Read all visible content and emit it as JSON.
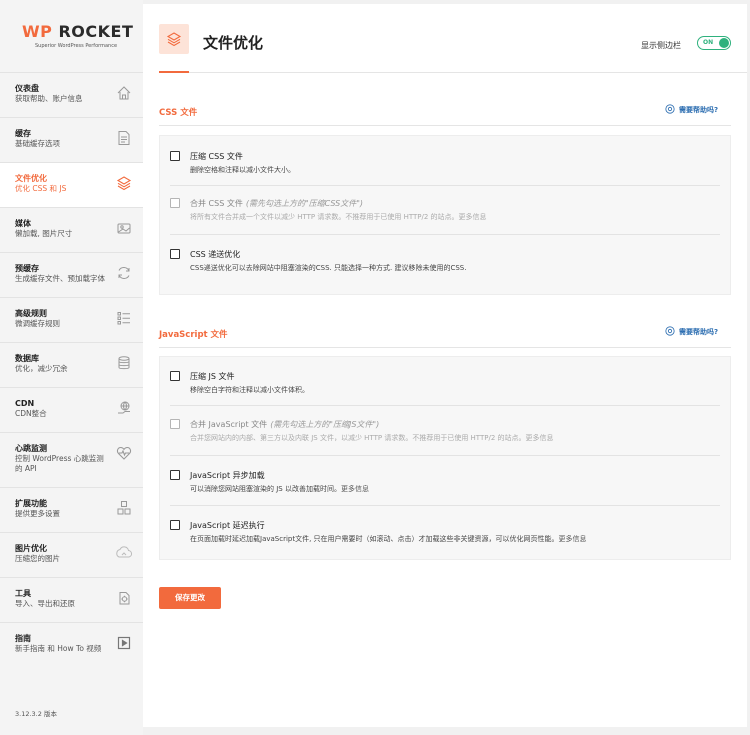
{
  "brand": {
    "name_wp": "WP",
    "name_rest": " ROCKET",
    "tagline": "Superior WordPress Performance"
  },
  "sidebar": {
    "items": [
      {
        "title": "仪表盘",
        "subtitle": "获取帮助、账户信息",
        "icon": "home-icon"
      },
      {
        "title": "缓存",
        "subtitle": "基础缓存选项",
        "icon": "file-icon"
      },
      {
        "title": "文件优化",
        "subtitle": "优化 CSS 和 JS",
        "icon": "layers-icon",
        "active": true
      },
      {
        "title": "媒体",
        "subtitle": "懒加载, 图片尺寸",
        "icon": "image-icon"
      },
      {
        "title": "预缓存",
        "subtitle": "生成缓存文件、预加载字体",
        "icon": "refresh-icon"
      },
      {
        "title": "高级规则",
        "subtitle": "微调缓存规则",
        "icon": "list-icon"
      },
      {
        "title": "数据库",
        "subtitle": "优化，减少冗余",
        "icon": "database-icon"
      },
      {
        "title": "CDN",
        "subtitle": "CDN整合",
        "icon": "cdn-icon"
      },
      {
        "title": "心跳监测",
        "subtitle": "控制 WordPress 心跳监测的 API",
        "icon": "heartbeat-icon"
      },
      {
        "title": "扩展功能",
        "subtitle": "提供更多设置",
        "icon": "addons-icon"
      },
      {
        "title": "图片优化",
        "subtitle": "压缩您的图片",
        "icon": "image-compress-icon"
      },
      {
        "title": "工具",
        "subtitle": "导入、导出和还原",
        "icon": "tools-icon"
      },
      {
        "title": "指南",
        "subtitle": "新手指南 和 How To 视频",
        "icon": "play-icon"
      }
    ],
    "version": "3.12.3.2 版本"
  },
  "header": {
    "title": "文件优化",
    "sidebar_toggle_label": "显示侧边栏",
    "toggle_state": "ON"
  },
  "css_section": {
    "title": "CSS 文件",
    "help": "需要帮助吗?",
    "options": [
      {
        "label": "压缩 CSS 文件",
        "hint": "",
        "desc": "删除空格和注释以减小文件大小。",
        "more": "",
        "disabled": false
      },
      {
        "label": "合并 CSS 文件",
        "hint": "(需先勾选上方的\"压缩CSS文件\")",
        "desc": "将所有文件合并成一个文件以减少 HTTP 请求数。不推荐用于已使用 HTTP/2 的站点。",
        "more": "更多信息",
        "disabled": true
      },
      {
        "label": "CSS 递送优化",
        "hint": "",
        "desc": "CSS递送优化可以去除网站中阻塞渲染的CSS. 只能选择一种方式. 建议移除未使用的CSS.",
        "more": "",
        "disabled": false
      }
    ]
  },
  "js_section": {
    "title": "JavaScript 文件",
    "help": "需要帮助吗?",
    "options": [
      {
        "label": "压缩 JS 文件",
        "hint": "",
        "desc": "移除空白字符和注释以减小文件体积。",
        "more": "",
        "disabled": false
      },
      {
        "label": "合并 JavaScript 文件",
        "hint": "(需先勾选上方的\"压缩JS文件\")",
        "desc": "合并您网站内的内部、第三方以及内联 JS 文件，以减少 HTTP 请求数。不推荐用于已使用 HTTP/2 的站点。",
        "more": "更多信息",
        "disabled": true
      },
      {
        "label": "JavaScript 异步加载",
        "hint": "",
        "desc": "可以消除您网站阻塞渲染的 JS 以改善加载时间。",
        "more": "更多信息",
        "disabled": false
      },
      {
        "label": "JavaScript 延迟执行",
        "hint": "",
        "desc": "在页面加载时延迟加载JavaScript文件, 只在用户需要时（如滚动、点击）才加载这些非关键资源，可以优化网页性能。",
        "more": "更多信息",
        "disabled": false
      }
    ]
  },
  "save_button": "保存更改",
  "colors": {
    "accent": "#f26a3d",
    "toggle": "#2eb17d",
    "link": "#2a6cb0"
  }
}
